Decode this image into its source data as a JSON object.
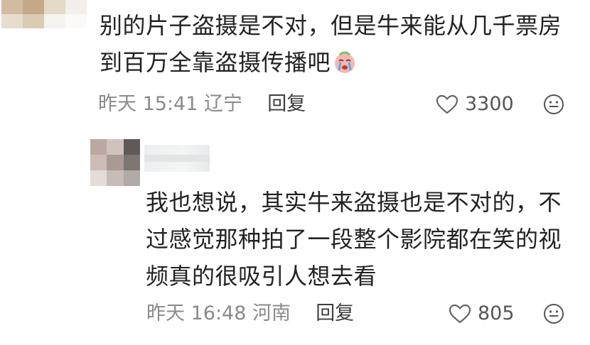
{
  "main_comment": {
    "avatar_colors": [
      "#cdb598",
      "#bfa07c",
      "#e3d5c3",
      "#f2eeea",
      "#e6d9c8",
      "#d8c6ad",
      "#f5f2ee",
      "#fbfaf8"
    ],
    "text": "别的片子盗摄是不对，但是牛来能从几千票房\n到百万全靠盗摄传播吧",
    "emoji_icon": "crying-face-icon",
    "time": "昨天 15:41",
    "location": "辽宁",
    "reply_label": "回复",
    "likes": "3300",
    "like_icon": "heart-outline-icon",
    "react_icon": "smile-icon"
  },
  "reply_comment": {
    "avatar_colors": [
      "#b9a9a2",
      "#d0c3bd",
      "#5f5a58",
      "#cdbcb5",
      "#a99a95",
      "#7c7674",
      "#e4dcd8",
      "#c6bcb8",
      "#b2aaa7"
    ],
    "text": "我也想说，其实牛来盗摄也是不对的，不\n过感觉那种拍了一段整个影院都在笑的视\n频真的很吸引人想去看",
    "time": "昨天 16:48",
    "location": "河南",
    "reply_label": "回复",
    "likes": "805",
    "like_icon": "heart-outline-icon",
    "react_icon": "smile-icon"
  }
}
